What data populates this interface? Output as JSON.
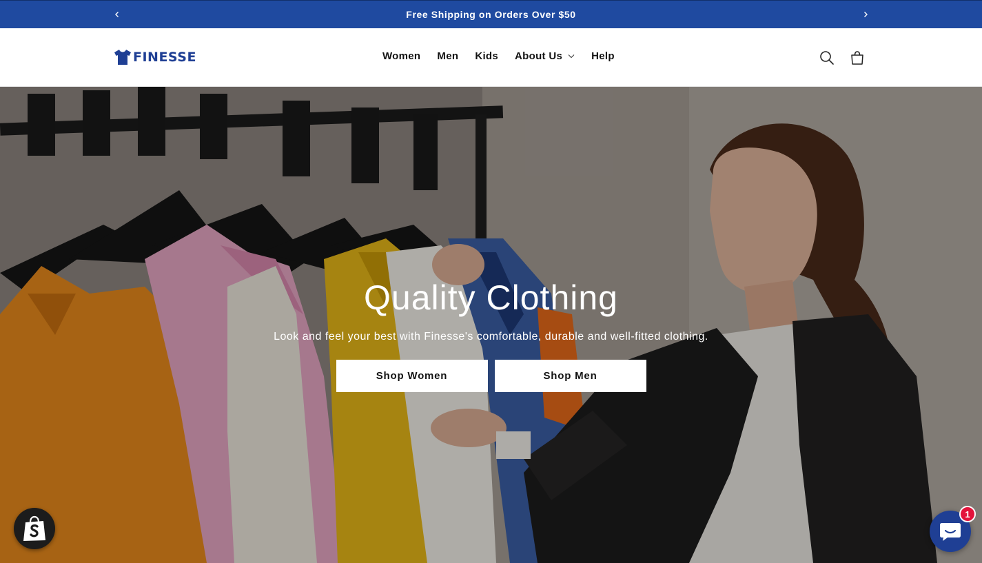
{
  "announcement": {
    "text": "Free Shipping on Orders Over $50",
    "prev_icon": "chevron-left-icon",
    "next_icon": "chevron-right-icon",
    "background": "#1f4aa0"
  },
  "header": {
    "logo_text": "FINESSE",
    "logo_icon": "tshirt-icon",
    "brand_color": "#1f3f94",
    "nav": {
      "women": "Women",
      "men": "Men",
      "kids": "Kids",
      "about": "About Us",
      "help": "Help"
    },
    "search_icon": "search-icon",
    "cart_icon": "cart-icon"
  },
  "hero": {
    "title": "Quality Clothing",
    "subtitle": "Look and feel your best with Finesse's comfortable, durable and well-fitted clothing.",
    "buttons": {
      "women": "Shop Women",
      "men": "Shop Men"
    }
  },
  "widgets": {
    "shop_icon": "shopify-bag-icon",
    "chat_icon": "chat-bubble-icon",
    "chat_badge_count": "1"
  }
}
